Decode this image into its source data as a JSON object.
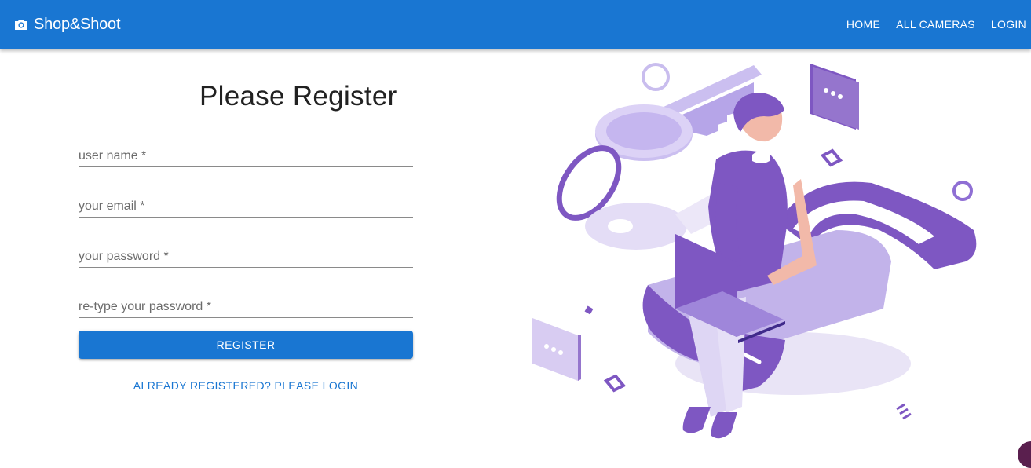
{
  "appbar": {
    "brand_icon": "camera-icon",
    "brand": "Shop&Shoot",
    "nav": [
      "HOME",
      "ALL CAMERAS",
      "LOGIN"
    ],
    "color": "#1976d2"
  },
  "form": {
    "title": "Please Register",
    "fields": {
      "username": {
        "placeholder": "user name *",
        "value": ""
      },
      "email": {
        "placeholder": "your email *",
        "value": ""
      },
      "password": {
        "placeholder": "your password *",
        "value": ""
      },
      "confirm": {
        "placeholder": "re-type your password *",
        "value": ""
      }
    },
    "register_label": "REGISTER",
    "login_link": "ALREADY REGISTERED? PLEASE LOGIN"
  },
  "illustration": {
    "subject": "person-on-padlock-with-laptop-illustration",
    "accent": "#7e57c2"
  }
}
